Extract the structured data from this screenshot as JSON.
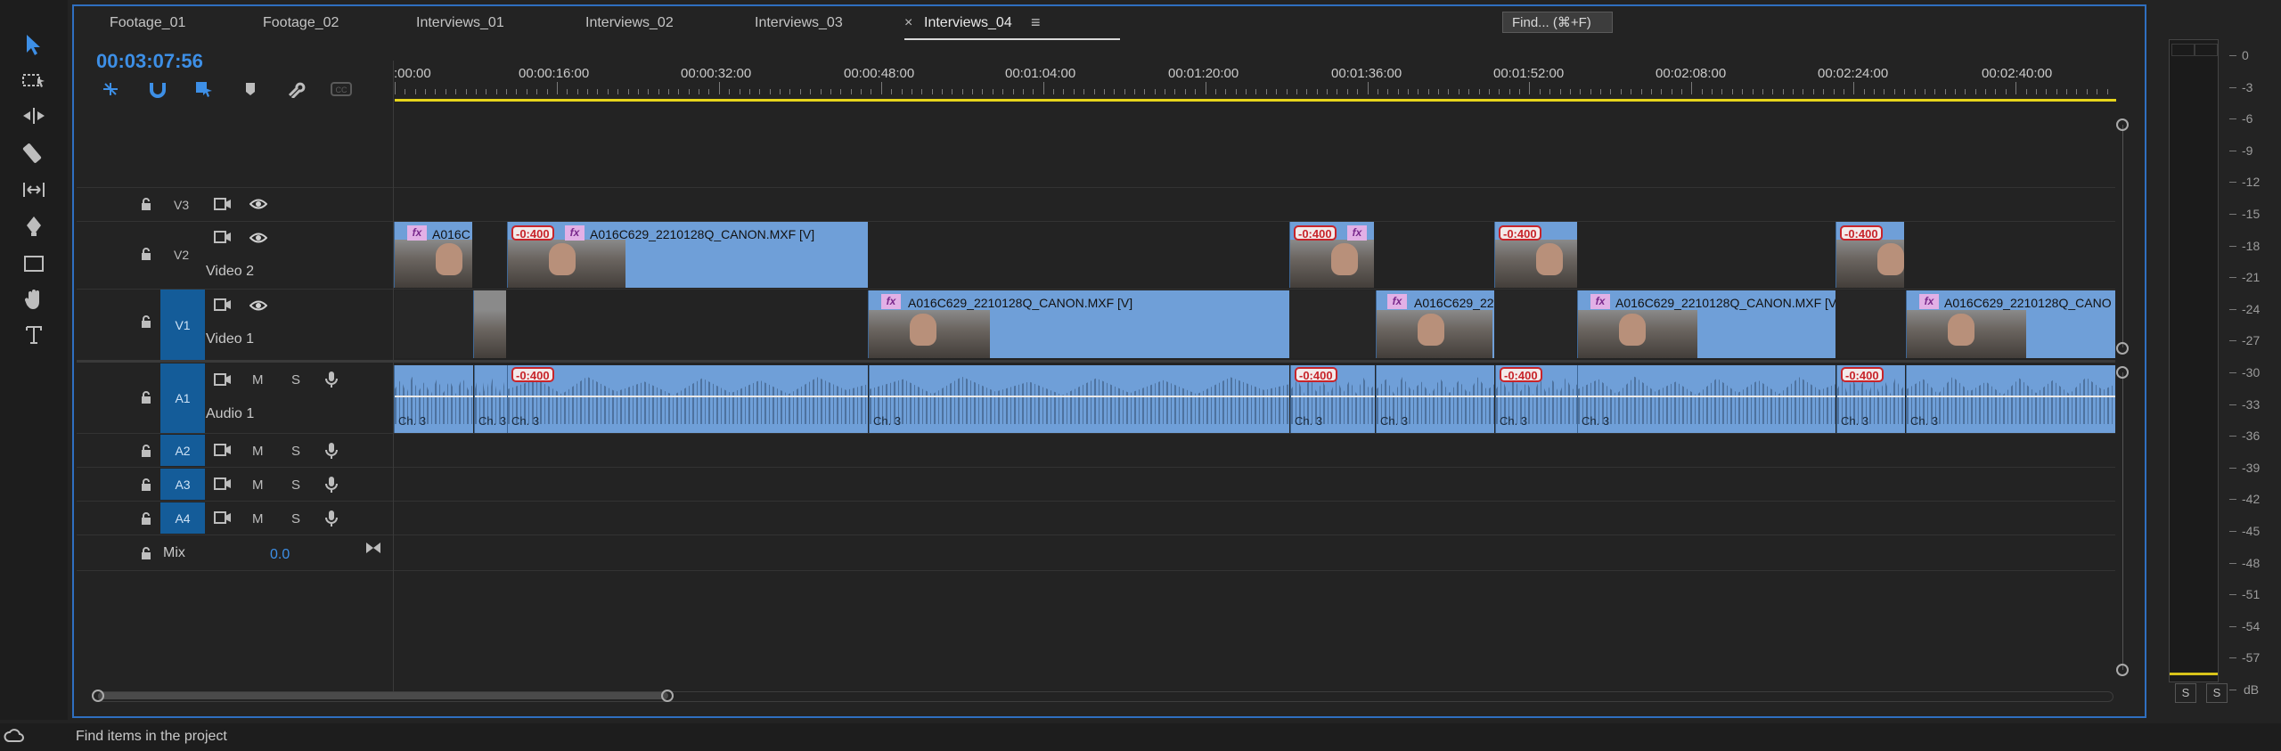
{
  "tabs": [
    {
      "label": "Footage_01"
    },
    {
      "label": "Footage_02"
    },
    {
      "label": "Interviews_01"
    },
    {
      "label": "Interviews_02"
    },
    {
      "label": "Interviews_03"
    },
    {
      "label": "Interviews_04"
    }
  ],
  "tab_close_glyph": "×",
  "tab_menu_glyph": "≡",
  "find_tooltip": "Find... (⌘+F)",
  "timecode": "00:03:07:56",
  "ruler": [
    ":00:00",
    "00:00:16:00",
    "00:00:32:00",
    "00:00:48:00",
    "00:01:04:00",
    "00:01:20:00",
    "00:01:36:00",
    "00:01:52:00",
    "00:02:08:00",
    "00:02:24:00",
    "00:02:40:00"
  ],
  "tracks": {
    "v3": {
      "label": "V3"
    },
    "v2": {
      "label": "V2",
      "name": "Video 2"
    },
    "v1": {
      "label": "V1",
      "name": "Video 1"
    },
    "a1": {
      "label": "A1",
      "name": "Audio 1",
      "m": "M",
      "s": "S"
    },
    "a2": {
      "label": "A2",
      "m": "M",
      "s": "S"
    },
    "a3": {
      "label": "A3",
      "m": "M",
      "s": "S"
    },
    "a4": {
      "label": "A4",
      "m": "M",
      "s": "S"
    },
    "mix": {
      "label": "Mix",
      "value": "0.0"
    }
  },
  "clips": {
    "v2_1": "A016C",
    "v2_2": "A016C629_2210128Q_CANON.MXF [V]",
    "v1_1": "A016C629_2210128Q_CANON.MXF [V]",
    "v1_2": "A016C629_22",
    "v1_3": "A016C629_2210128Q_CANON.MXF [V",
    "v1_4": "A016C629_2210128Q_CANO",
    "fx": "fx",
    "xfade": "-0:400",
    "channel": "Ch. 3"
  },
  "meter_scale": [
    "0",
    "-3",
    "-6",
    "-9",
    "-12",
    "-15",
    "-18",
    "-21",
    "-24",
    "-27",
    "-30",
    "-33",
    "-36",
    "-39",
    "-42",
    "-45",
    "-48",
    "-51",
    "-54",
    "-57",
    "dB"
  ],
  "meter_solo": [
    "S",
    "S"
  ],
  "status": "Find items in the project",
  "colors": {
    "accent": "#2f6fc0",
    "timecode": "#3d8fe6",
    "clip": "#6f9fd8",
    "workbar": "#e6d51b",
    "xfade": "#c7242a"
  }
}
